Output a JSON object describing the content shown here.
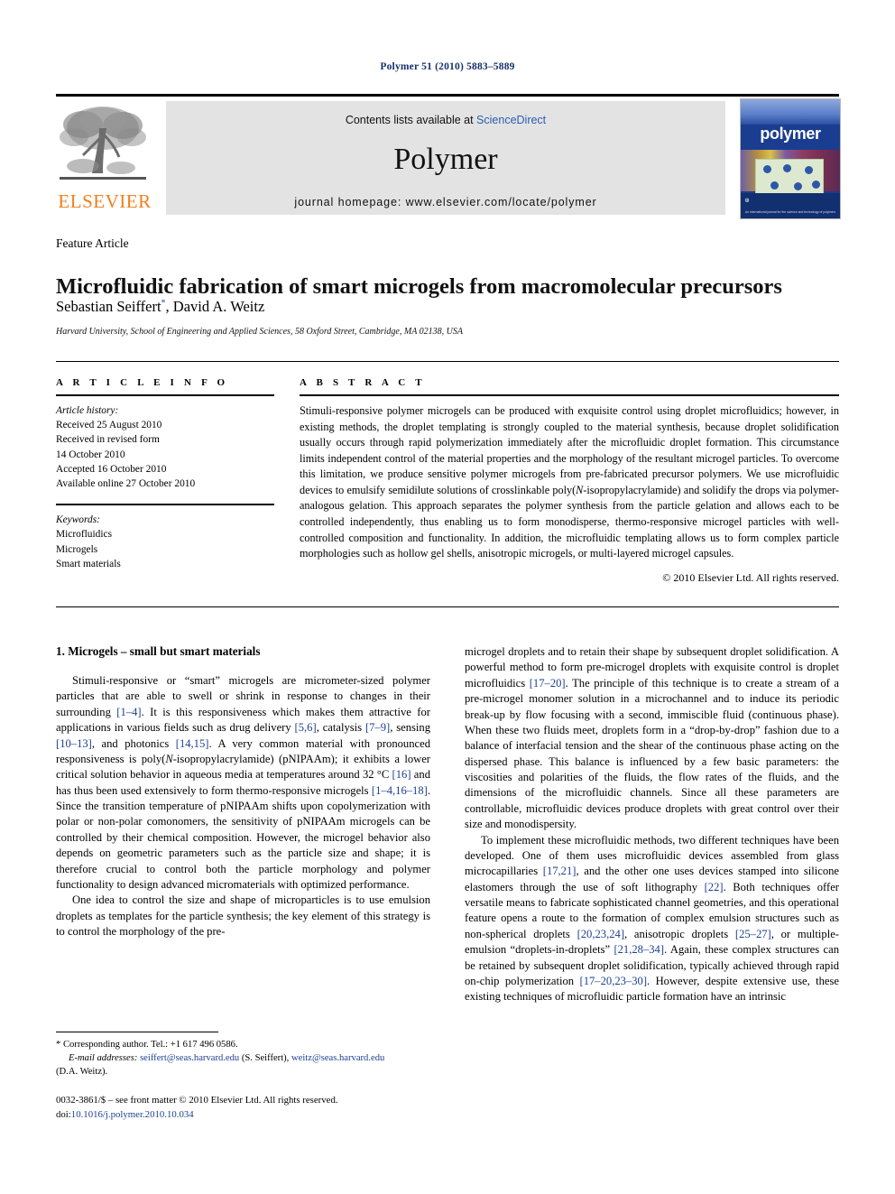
{
  "running_head": "Polymer 51 (2010) 5883–5889",
  "masthead": {
    "contents_prefix": "Contents lists available at ",
    "contents_link": "ScienceDirect",
    "journal_title": "Polymer",
    "homepage": "journal homepage: www.elsevier.com/locate/polymer",
    "publisher_wordmark": "ELSEVIER",
    "cover_word": "polymer",
    "cover_footer": "An international journal for the science and technology of polymers"
  },
  "article": {
    "feature_label": "Feature Article",
    "title": "Microfluidic fabrication of smart microgels from macromolecular precursors",
    "authors": "Sebastian Seiffert",
    "author_marker": "*",
    "authors_rest": ", David A. Weitz",
    "affiliation": "Harvard University, School of Engineering and Applied Sciences, 58 Oxford Street, Cambridge, MA 02138, USA"
  },
  "info": {
    "heading": "A R T I C L E   I N F O",
    "history_label": "Article history:",
    "history": [
      "Received 25 August 2010",
      "Received in revised form",
      "14 October 2010",
      "Accepted 16 October 2010",
      "Available online 27 October 2010"
    ],
    "keywords_label": "Keywords:",
    "keywords": [
      "Microfluidics",
      "Microgels",
      "Smart materials"
    ]
  },
  "abstract": {
    "heading": "A B S T R A C T",
    "text": "Stimuli-responsive polymer microgels can be produced with exquisite control using droplet microfluidics; however, in existing methods, the droplet templating is strongly coupled to the material synthesis, because droplet solidification usually occurs through rapid polymerization immediately after the microfluidic droplet formation. This circumstance limits independent control of the material properties and the morphology of the resultant microgel particles. To overcome this limitation, we produce sensitive polymer microgels from pre-fabricated precursor polymers. We use microfluidic devices to emulsify semidilute solutions of crosslinkable poly(N-isopropylacrylamide) and solidify the drops via polymer-analogous gelation. This approach separates the polymer synthesis from the particle gelation and allows each to be controlled independently, thus enabling us to form monodisperse, thermo-responsive microgel particles with well-controlled composition and functionality. In addition, the microfluidic templating allows us to form complex particle morphologies such as hollow gel shells, anisotropic microgels, or multi-layered microgel capsules.",
    "copyright": "© 2010 Elsevier Ltd. All rights reserved."
  },
  "body": {
    "section_title": "1. Microgels – small but smart materials",
    "left_paragraphs": [
      "Stimuli-responsive or “smart” microgels are micrometer-sized polymer particles that are able to swell or shrink in response to changes in their surrounding [1–4]. It is this responsiveness which makes them attractive for applications in various fields such as drug delivery [5,6], catalysis [7–9], sensing [10–13], and photonics [14,15]. A very common material with pronounced responsiveness is poly(N-isopropylacrylamide) (pNIPAAm); it exhibits a lower critical solution behavior in aqueous media at temperatures around 32 °C [16] and has thus been used extensively to form thermo-responsive microgels [1–4,16–18]. Since the transition temperature of pNIPAAm shifts upon copolymerization with polar or non-polar comonomers, the sensitivity of pNIPAAm microgels can be controlled by their chemical composition. However, the microgel behavior also depends on geometric parameters such as the particle size and shape; it is therefore crucial to control both the particle morphology and polymer functionality to design advanced micromaterials with optimized performance.",
      "One idea to control the size and shape of microparticles is to use emulsion droplets as templates for the particle synthesis; the key element of this strategy is to control the morphology of the pre-"
    ],
    "right_paragraphs": [
      "microgel droplets and to retain their shape by subsequent droplet solidification. A powerful method to form pre-microgel droplets with exquisite control is droplet microfluidics [17–20]. The principle of this technique is to create a stream of a pre-microgel monomer solution in a microchannel and to induce its periodic break-up by flow focusing with a second, immiscible fluid (continuous phase). When these two fluids meet, droplets form in a “drop-by-drop” fashion due to a balance of interfacial tension and the shear of the continuous phase acting on the dispersed phase. This balance is influenced by a few basic parameters: the viscosities and polarities of the fluids, the flow rates of the fluids, and the dimensions of the microfluidic channels. Since all these parameters are controllable, microfluidic devices produce droplets with great control over their size and monodispersity.",
      "To implement these microfluidic methods, two different techniques have been developed. One of them uses microfluidic devices assembled from glass microcapillaries [17,21], and the other one uses devices stamped into silicone elastomers through the use of soft lithography [22]. Both techniques offer versatile means to fabricate sophisticated channel geometries, and this operational feature opens a route to the formation of complex emulsion structures such as non-spherical droplets [20,23,24], anisotropic droplets [25–27], or multiple-emulsion “droplets-in-droplets” [21,28–34]. Again, these complex structures can be retained by subsequent droplet solidification, typically achieved through rapid on-chip polymerization [17–20,23–30]. However, despite extensive use, these existing techniques of microfluidic particle formation have an intrinsic"
    ]
  },
  "footnotes": {
    "corresponding": "* Corresponding author. Tel.: +1 617 496 0586.",
    "email_label": "E-mail addresses:",
    "email1": "seiffert@seas.harvard.edu",
    "email1_name": " (S. Seiffert),",
    "email2": "weitz@seas.harvard.edu",
    "email2_name": "(D.A. Weitz)."
  },
  "imprint": {
    "line1": "0032-3861/$ – see front matter © 2010 Elsevier Ltd. All rights reserved.",
    "doi_label": "doi:",
    "doi": "10.1016/j.polymer.2010.10.034"
  }
}
